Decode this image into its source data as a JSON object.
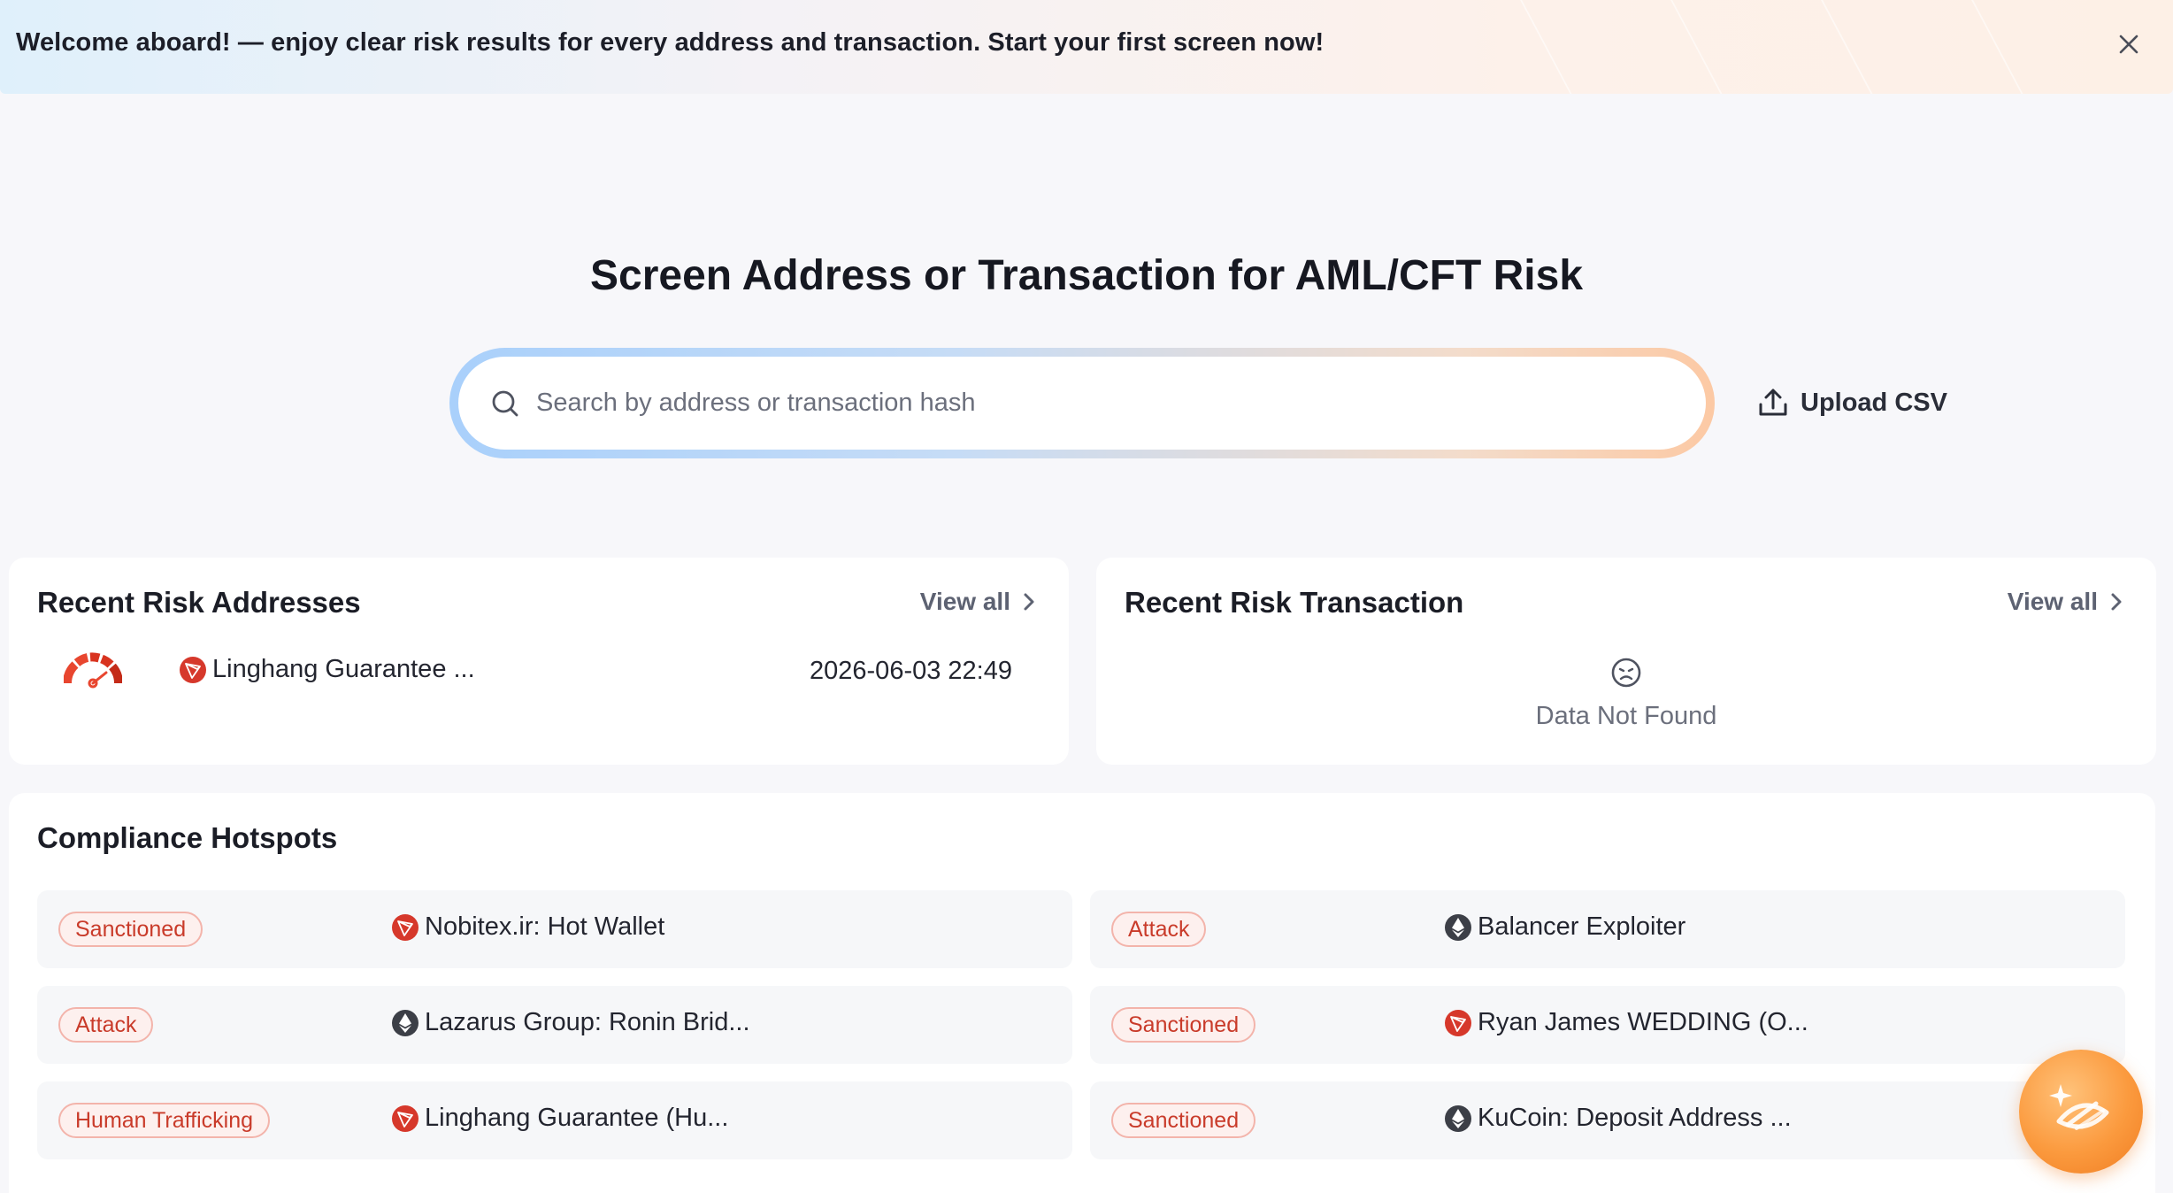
{
  "banner": {
    "text": "Welcome aboard! — enjoy clear risk results for every address and transaction. Start your first screen now!"
  },
  "hero": {
    "title": "Screen Address or Transaction for AML/CFT Risk",
    "search_placeholder": "Search by address or transaction hash",
    "upload_label": "Upload CSV"
  },
  "recent_addresses": {
    "title": "Recent Risk Addresses",
    "view_all": "View all",
    "items": [
      {
        "name": "Linghang Guarantee ...",
        "time": "2026-06-03 22:49",
        "chain": "tron-icon"
      }
    ]
  },
  "recent_transactions": {
    "title": "Recent Risk Transaction",
    "view_all": "View all",
    "empty_text": "Data Not Found"
  },
  "hotspots": {
    "title": "Compliance Hotspots",
    "items": [
      {
        "tag": "Sanctioned",
        "name": "Nobitex.ir: Hot Wallet",
        "chain": "tron-icon"
      },
      {
        "tag": "Attack",
        "name": "Balancer Exploiter",
        "chain": "ethereum-icon"
      },
      {
        "tag": "Attack",
        "name": "Lazarus Group: Ronin Brid...",
        "chain": "ethereum-icon"
      },
      {
        "tag": "Sanctioned",
        "name": "Ryan James WEDDING (O...",
        "chain": "tron-icon"
      },
      {
        "tag": "Human Trafficking",
        "name": "Linghang Guarantee (Hu...",
        "chain": "tron-icon"
      },
      {
        "tag": "Sanctioned",
        "name": "KuCoin: Deposit Address ...",
        "chain": "ethereum-icon"
      }
    ]
  },
  "colors": {
    "tron_red": "#d6382b",
    "eth_dark": "#3c3f47",
    "badge_red": "#c93b2a",
    "accent_orange": "#f59a44"
  }
}
